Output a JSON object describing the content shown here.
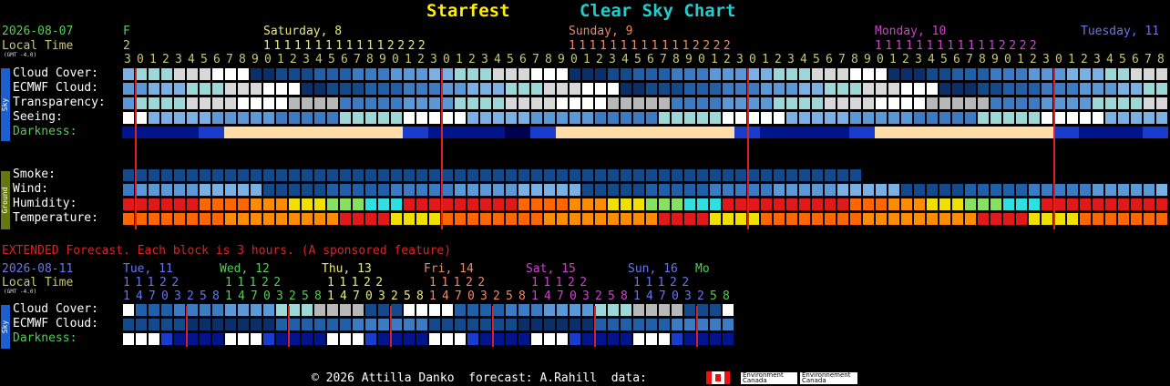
{
  "header": {
    "title": "Starfest",
    "subtitle": "Clear Sky Chart"
  },
  "colors": {
    "title": "#ffee00",
    "subtitle": "#22cccc",
    "date": "#55cc55",
    "local": "#c8c870",
    "gmt": "#dddddd",
    "extended": "#dd2222",
    "sat": "#e8e880",
    "sun": "#ee8866",
    "mon": "#cc44cc",
    "tue": "#6677ee",
    "wed": "#55cc55",
    "thu": "#e8e880",
    "fri": "#ee8866",
    "sat2": "#cc44cc",
    "sun2": "#6677ee",
    "mo": "#55cc55"
  },
  "main": {
    "date": "2026-08-07",
    "local_time": "Local Time",
    "gmt": "(GMT -4.0)",
    "day_label_fri": "F",
    "day_label_fri_date": "2",
    "days": [
      {
        "label": "Saturday, 8"
      },
      {
        "label": "Sunday, 9"
      },
      {
        "label": "Monday, 10"
      },
      {
        "label": "Tuesday, 11"
      }
    ],
    "hour_tens": "1111111111112222",
    "hours": "301234567890123456789012301234567890123456789012301234567890123456789012301234567890123456789012301234567890123456789012345678",
    "sky_rows": [
      "Cloud Cover:",
      "ECMWF Cloud:",
      "Transparency:",
      "Seeing:",
      "Darkness:"
    ],
    "ground_rows": [
      "Smoke:",
      "Wind:",
      "Humidity:",
      "Temperature:"
    ],
    "sky_label": "Sky",
    "ground_label": "Ground"
  },
  "extended": {
    "notice": "EXTENDED Forecast. Each block is 3 hours. (A sponsored feature)",
    "date": "2026-08-11",
    "local_time": "Local Time",
    "gmt": "(GMT -4.0)",
    "days": [
      "Tue, 11",
      "Wed, 12",
      "Thu, 13",
      "Fri, 14",
      "Sat, 15",
      "Sun, 16",
      "Mo"
    ],
    "hour_tens": "11122",
    "hours": "147032581470325814703258147032581470325814703258",
    "rows": [
      "Cloud Cover:",
      "ECMWF Cloud:",
      "Darkness:"
    ],
    "sky_label": "Sky"
  },
  "footer": {
    "copyright": "© 2026 Attilla Danko  forecast: A.Rahill  data:",
    "env1": "Environment Canada",
    "env2": "Environnement Canada"
  },
  "legend_names": [
    "canada-flag-icon"
  ]
}
